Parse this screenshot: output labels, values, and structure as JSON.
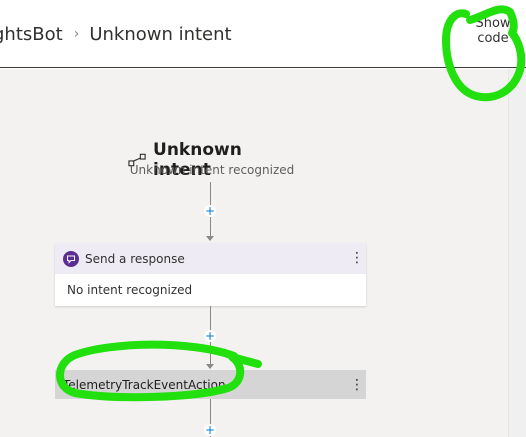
{
  "header": {
    "bot_name": "ghtsBot",
    "separator": "›",
    "dialog_name": "Unknown intent",
    "show_code_line1": "Show",
    "show_code_line2": "code"
  },
  "trigger": {
    "title": "Unknown intent",
    "subtitle": "Unknown intent recognized",
    "icon": "trigger-icon"
  },
  "nodes": [
    {
      "title": "Send a response",
      "icon": "message-icon",
      "body": "No intent recognized"
    },
    {
      "title": "TelemetryTrackEventAction"
    }
  ],
  "controls": {
    "add_symbol": "+",
    "more_symbol": "⋮"
  },
  "colors": {
    "annotation": "#22e00e",
    "accent": "#0078d4",
    "message_icon": "#5c2e91"
  }
}
